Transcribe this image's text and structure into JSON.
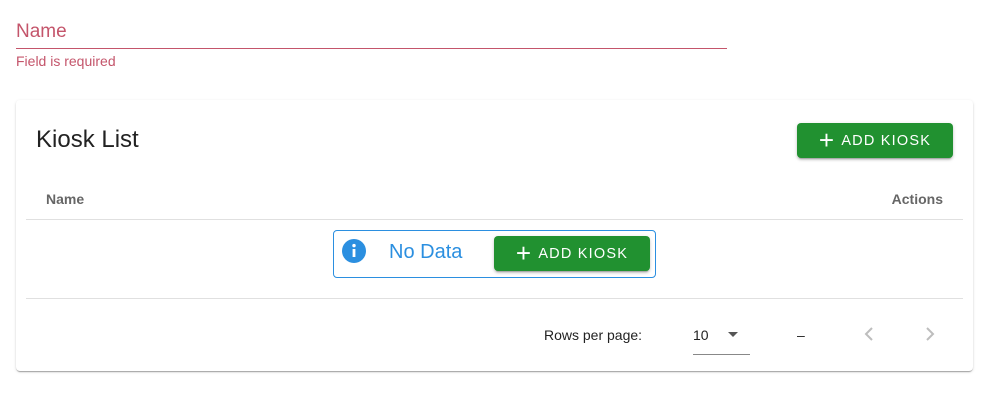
{
  "name_field": {
    "label": "Name",
    "value": "",
    "error": "Field is required"
  },
  "kiosk_card": {
    "title": "Kiosk List",
    "add_button_label": "ADD KIOSK",
    "add_button_icon": "plus-icon",
    "columns": [
      "Name",
      "Actions"
    ],
    "rows": [],
    "empty_state": {
      "icon": "info-icon",
      "text": "No Data",
      "add_button_label": "ADD KIOSK"
    },
    "pagination": {
      "rows_per_page_label": "Rows per page:",
      "rows_per_page_value": "10",
      "range_text": "–",
      "prev_icon": "chevron-left-icon",
      "next_icon": "chevron-right-icon"
    }
  },
  "colors": {
    "error": "#c4556b",
    "primary_button": "#219130",
    "info": "#2b8fe0"
  }
}
